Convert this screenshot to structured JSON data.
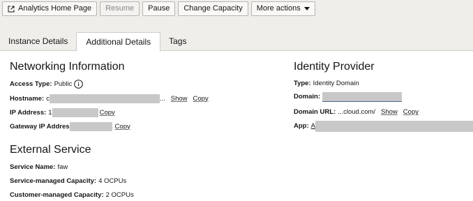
{
  "toolbar": {
    "home_label": "Analytics Home Page",
    "resume_label": "Resume",
    "pause_label": "Pause",
    "capacity_label": "Change Capacity",
    "more_label": "More actions"
  },
  "tabs": [
    {
      "label": "Instance Details",
      "active": false
    },
    {
      "label": "Additional Details",
      "active": true
    },
    {
      "label": "Tags",
      "active": false
    }
  ],
  "networking": {
    "title": "Networking Information",
    "access_type_label": "Access Type:",
    "access_type_value": "Public",
    "hostname_label": "Hostname:",
    "hostname_prefix": "c",
    "hostname_ellipsis": "...",
    "ip_label": "IP Address:",
    "ip_prefix": "1",
    "gateway_label": "Gateway IP Addres",
    "show_label": "Show",
    "copy_label": "Copy"
  },
  "external": {
    "title": "External Service",
    "service_name_label": "Service Name:",
    "service_name_value": "faw",
    "service_cap_label": "Service-managed Capacity:",
    "service_cap_value": "4 OCPUs",
    "customer_cap_label": "Customer-managed Capacity:",
    "customer_cap_value": "2 OCPUs"
  },
  "identity": {
    "title": "Identity Provider",
    "type_label": "Type:",
    "type_value": "Identity Domain",
    "domain_label": "Domain:",
    "domain_url_label": "Domain URL:",
    "domain_url_value": "...cloud.com/",
    "show_label": "Show",
    "copy_label": "Copy",
    "app_label": "App:",
    "app_prefix": "A"
  },
  "colors": {
    "band": "#f0eeeb",
    "border": "#cfcac4",
    "redaction": "#c8c8c8",
    "text": "#161513"
  },
  "icons": {
    "home": "external-link-icon",
    "more": "caret-down-icon",
    "info": "info-circle-icon"
  }
}
